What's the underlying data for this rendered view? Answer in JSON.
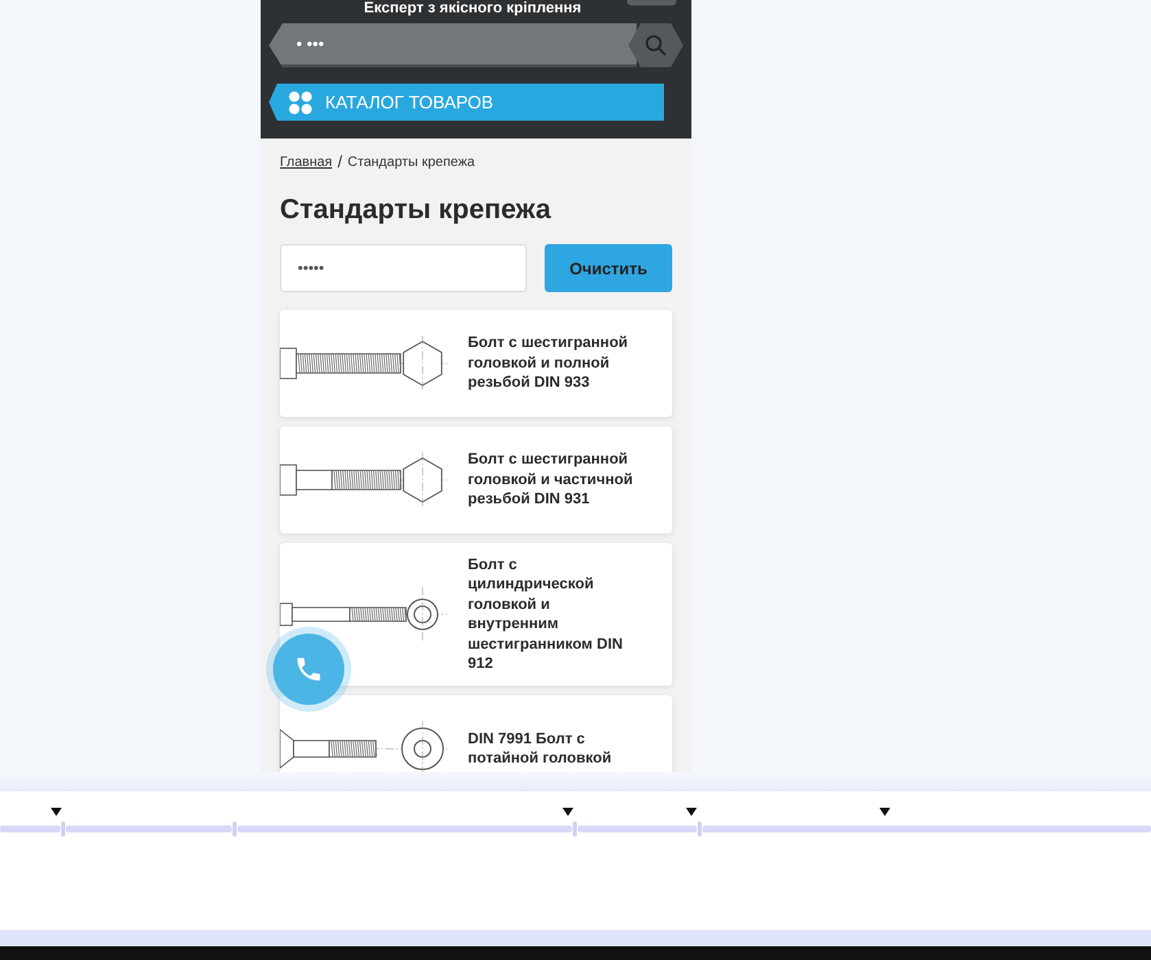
{
  "header": {
    "tagline": "Експерт з якісного кріплення",
    "search": {
      "value": "• •••"
    },
    "catalog_button": "КАТАЛОГ ТОВАРОВ"
  },
  "breadcrumbs": [
    {
      "label": "Главная",
      "link": true
    },
    {
      "label": "Стандарты крепежа",
      "link": false
    }
  ],
  "breadcrumb_separator": "/",
  "title": "Стандарты крепежа",
  "filter": {
    "value": "•••••",
    "button": "Очистить"
  },
  "products": [
    {
      "title": "Болт с шестигранной головкой и полной резьбой DIN 933",
      "kind": "hex-full"
    },
    {
      "title": "Болт с шестигранной головкой и частичной резьбой DIN 931",
      "kind": "hex-partial"
    },
    {
      "title": "Болт с цилиндрической головкой и внутренним шестигранником DIN 912",
      "kind": "socket"
    },
    {
      "title": "DIN 7991 Болт с потайной головкой",
      "kind": "countersunk"
    }
  ]
}
